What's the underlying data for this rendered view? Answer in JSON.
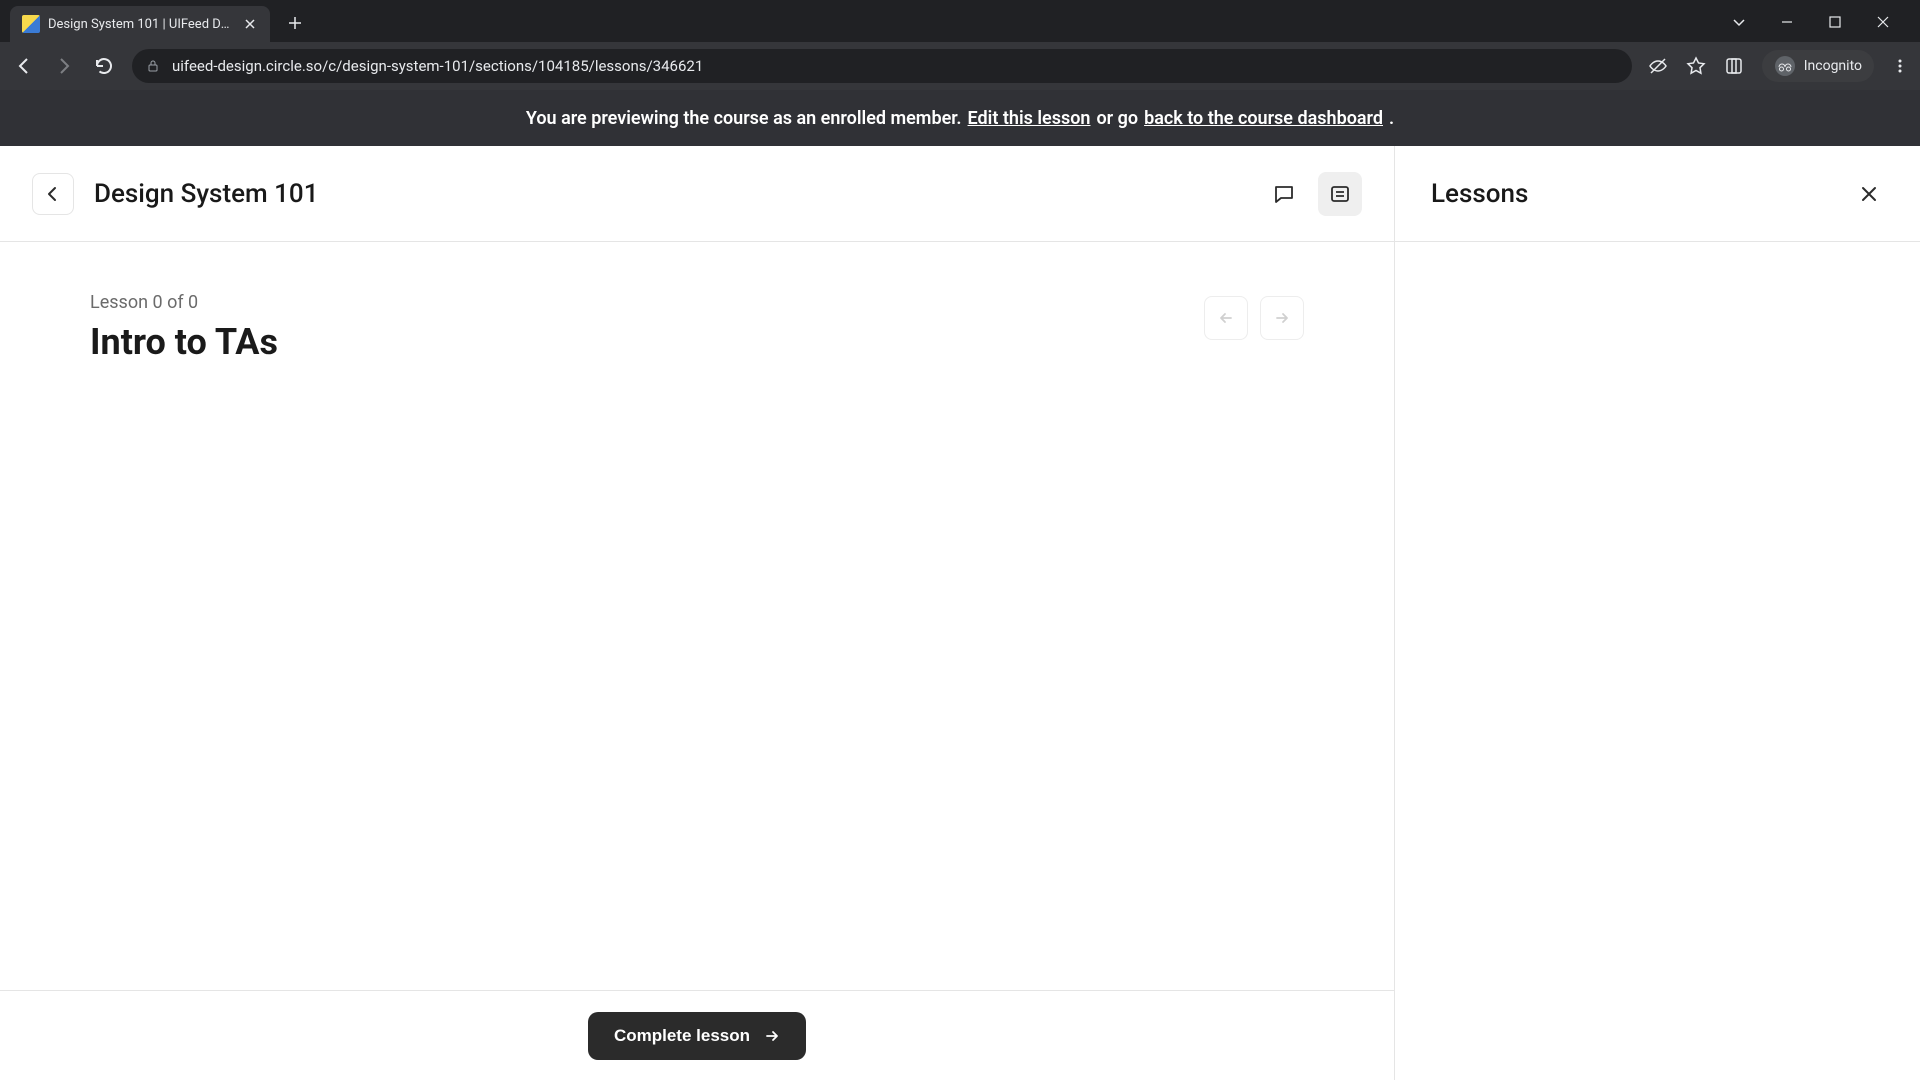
{
  "browser": {
    "tab_title": "Design System 101 | UIFeed Desi",
    "url": "uifeed-design.circle.so/c/design-system-101/sections/104185/lessons/346621",
    "incognito_label": "Incognito"
  },
  "banner": {
    "prefix": "You are previewing the course as an enrolled member. ",
    "edit_link": "Edit this lesson",
    "middle": " or go ",
    "back_link": "back to the course dashboard",
    "suffix": "."
  },
  "header": {
    "course_title": "Design System 101"
  },
  "lesson": {
    "counter": "Lesson 0 of 0",
    "title": "Intro to TAs",
    "complete_label": "Complete lesson"
  },
  "sidebar": {
    "title": "Lessons"
  }
}
